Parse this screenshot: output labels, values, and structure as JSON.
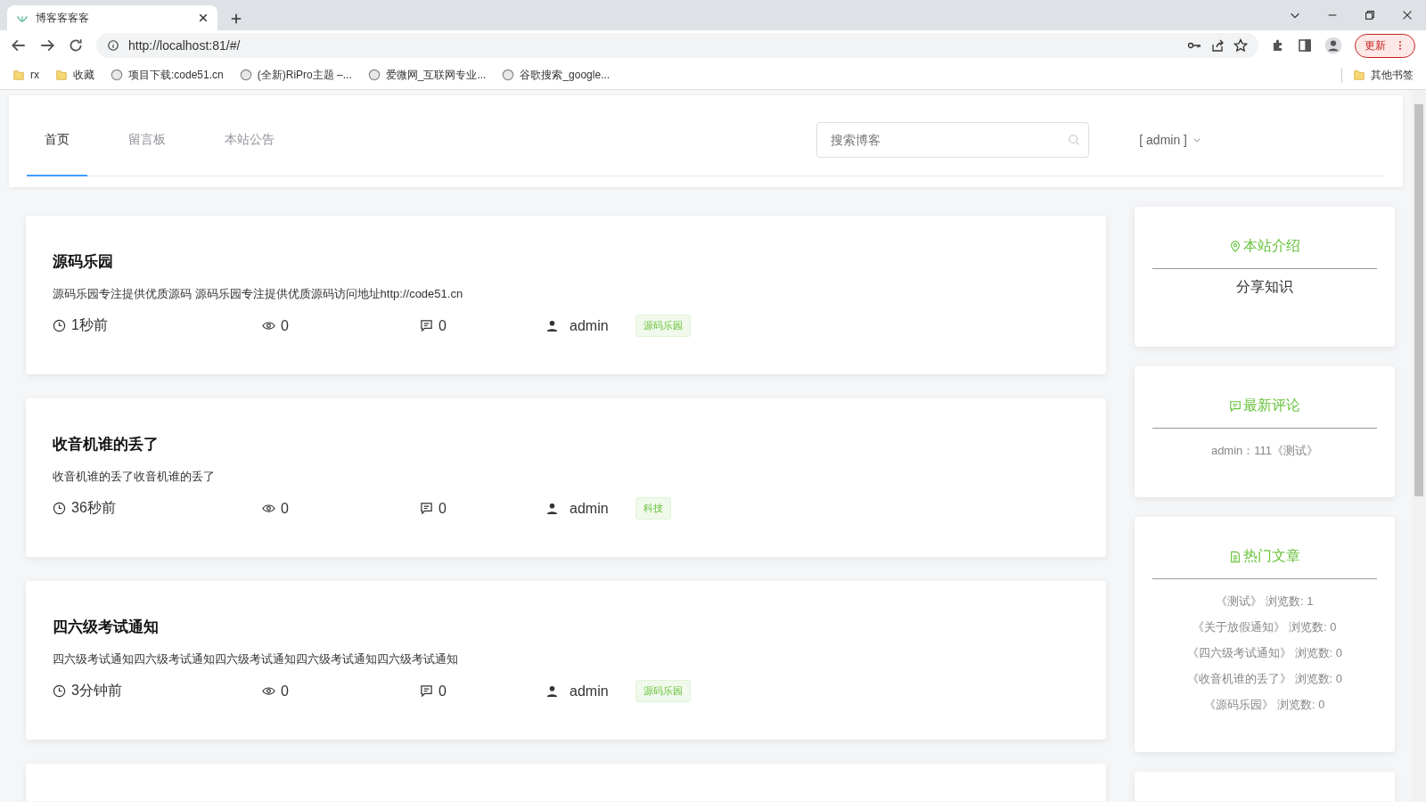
{
  "browser": {
    "tab_title": "博客客客客",
    "address": "http://localhost:81/#/",
    "update_button": "更新",
    "bookmarks": [
      {
        "label": "rx",
        "kind": "folder"
      },
      {
        "label": "收藏",
        "kind": "folder"
      },
      {
        "label": "项目下载:code51.cn",
        "kind": "site"
      },
      {
        "label": "(全新)RiPro主题 –...",
        "kind": "site"
      },
      {
        "label": "爱微网_互联网专业...",
        "kind": "site"
      },
      {
        "label": "谷歌搜索_google...",
        "kind": "site"
      }
    ],
    "other_bookmarks": "其他书签"
  },
  "nav": {
    "tabs": [
      {
        "label": "首页",
        "selected": true
      },
      {
        "label": "留言板",
        "selected": false
      },
      {
        "label": "本站公告",
        "selected": false
      }
    ],
    "search": {
      "placeholder": "搜索博客"
    },
    "user": "[ admin ]"
  },
  "posts": [
    {
      "title": "源码乐园",
      "summary": "源码乐园专注提供优质源码 源码乐园专注提供优质源码访问地址http://code51.cn",
      "time": "1秒前",
      "views": "0",
      "comments": "0",
      "author": "admin",
      "tag": "源码乐园"
    },
    {
      "title": "收音机谁的丢了",
      "summary": "收音机谁的丢了收音机谁的丢了",
      "time": "36秒前",
      "views": "0",
      "comments": "0",
      "author": "admin",
      "tag": "科技"
    },
    {
      "title": "四六级考试通知",
      "summary": "四六级考试通知四六级考试通知四六级考试通知四六级考试通知四六级考试通知",
      "time": "3分钟前",
      "views": "0",
      "comments": "0",
      "author": "admin",
      "tag": "源码乐园"
    }
  ],
  "sidebar": {
    "about": {
      "title": "本站介绍",
      "text": "分享知识"
    },
    "latest_comments": {
      "title": "最新评论",
      "items": [
        "admin：111《测试》"
      ]
    },
    "hot_posts": {
      "title": "热门文章",
      "items": [
        "《测试》 浏览数: 1",
        "《关于放假通知》 浏览数: 0",
        "《四六级考试通知》 浏览数: 0",
        "《收音机谁的丢了》 浏览数: 0",
        "《源码乐园》 浏览数: 0"
      ]
    }
  }
}
